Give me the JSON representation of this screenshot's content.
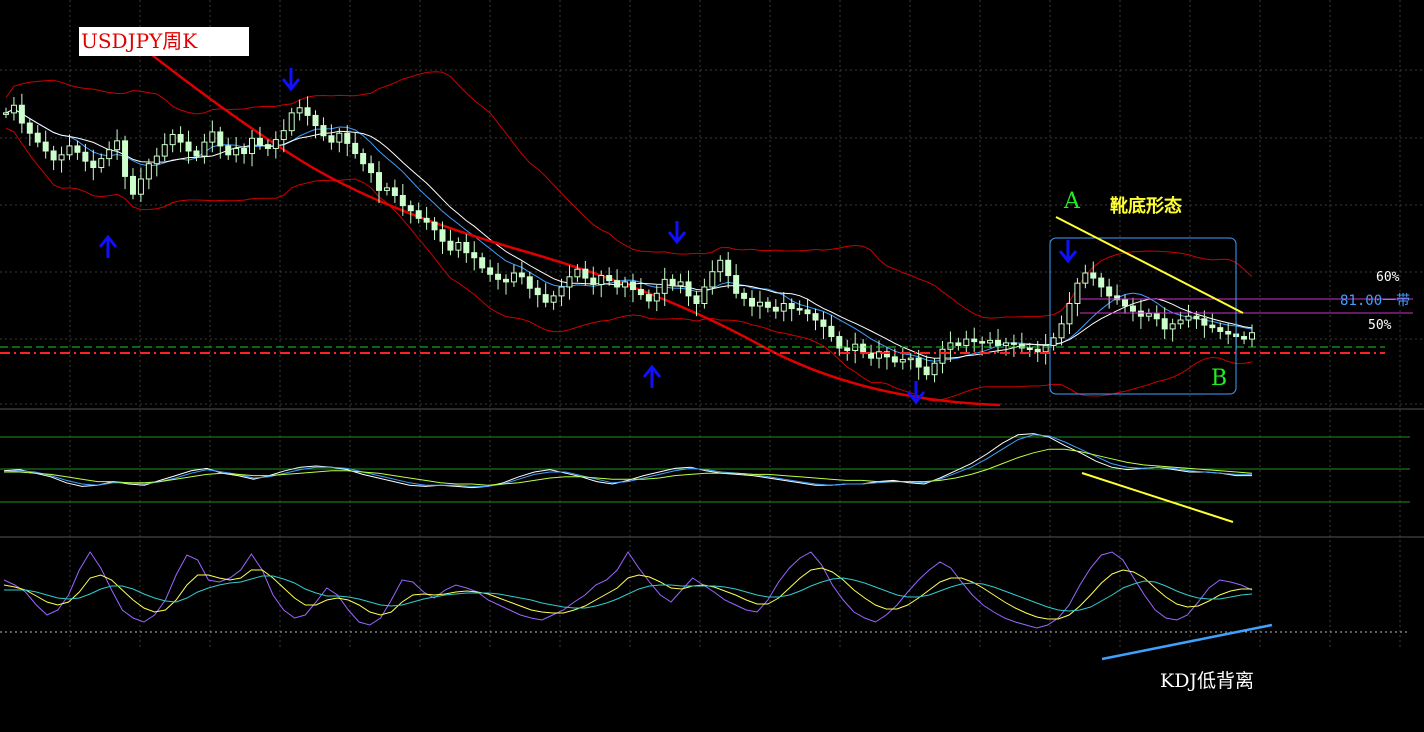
{
  "title": "USDJPY周K",
  "annotations": {
    "point_a": "A",
    "point_b": "B",
    "pattern": "靴底形态",
    "fib_60": "60%",
    "level_81": "81.00一带",
    "fib_50": "50%",
    "kdj_divergence": "KDJ低背离"
  },
  "colors": {
    "background": "#000000",
    "candle_up": "#ccffcc",
    "candle_down": "#ccffcc",
    "bollinger": "#cc0000",
    "ma_long": "#e00000",
    "ma_white": "#ffffff",
    "ma_blue": "#3f9fff",
    "arrow": "#1010ff",
    "trend_yellow": "#ffff33",
    "trend_blue": "#3fa0ff",
    "box": "#3f9fff",
    "fib_line": "#cc33cc",
    "label_green": "#22ee22"
  },
  "chart_data": [
    {
      "type": "candlestick",
      "panel": "price",
      "title": "USDJPY周K",
      "x": "weeks (index)",
      "series": [
        {
          "name": "close",
          "values": [
            101.2,
            101.8,
            100.4,
            99.6,
            98.9,
            98.2,
            97.5,
            97.9,
            98.6,
            98.1,
            97.4,
            96.9,
            97.6,
            98.3,
            99.0,
            96.2,
            94.8,
            96.0,
            97.2,
            97.8,
            98.7,
            99.5,
            98.9,
            98.2,
            97.8,
            98.9,
            99.7,
            98.6,
            97.9,
            98.4,
            98.0,
            99.2,
            98.7,
            98.4,
            99.1,
            99.8,
            101.2,
            101.6,
            101.0,
            100.2,
            99.4,
            98.9,
            99.6,
            98.8,
            98.0,
            97.2,
            96.5,
            95.1,
            95.3,
            94.7,
            93.9,
            93.5,
            92.9,
            92.6,
            92.0,
            91.1,
            90.4,
            91.0,
            90.2,
            89.8,
            89.0,
            88.5,
            88.1,
            87.9,
            88.6,
            88.3,
            87.4,
            86.9,
            86.3,
            86.8,
            87.5,
            88.3,
            88.9,
            88.2,
            87.7,
            88.4,
            88.0,
            87.5,
            87.9,
            87.3,
            86.9,
            86.4,
            87.0,
            88.1,
            87.6,
            87.9,
            86.8,
            86.2,
            87.5,
            88.7,
            89.6,
            88.4,
            87.0,
            86.6,
            86.0,
            86.3,
            85.9,
            85.6,
            86.2,
            85.8,
            85.7,
            85.4,
            84.9,
            84.4,
            83.6,
            82.7,
            82.5,
            83.0,
            82.3,
            81.9,
            82.4,
            82.0,
            81.6,
            81.8,
            81.9,
            81.2,
            80.6,
            81.5,
            82.6,
            83.1,
            82.9,
            83.4,
            83.2,
            83.1,
            83.3,
            82.9,
            83.1,
            83.0,
            82.7,
            82.6,
            82.4,
            82.9,
            83.5,
            84.6,
            86.2,
            87.8,
            88.6,
            88.2,
            87.5,
            86.8,
            86.5,
            86.0,
            85.6,
            85.2,
            85.4,
            85.0,
            84.2,
            84.6,
            84.9,
            85.2,
            85.0,
            84.5,
            84.3,
            84.0,
            83.8,
            83.6,
            83.4,
            83.9
          ]
        }
      ]
    },
    {
      "type": "line",
      "panel": "oscillator",
      "series": [
        {
          "name": "white",
          "values": [
            0.6,
            0.7,
            0.4,
            0.1,
            -0.4,
            -0.7,
            -0.6,
            -0.3,
            -0.5,
            -0.6,
            -0.2,
            0.2,
            0.6,
            0.8,
            0.4,
            0.2,
            -0.1,
            0.2,
            0.6,
            0.9,
            1.0,
            0.9,
            0.7,
            0.3,
            0.0,
            -0.3,
            -0.6,
            -0.7,
            -0.6,
            -0.7,
            -0.8,
            -0.7,
            -0.4,
            0.1,
            0.5,
            0.7,
            0.4,
            0.1,
            -0.3,
            -0.5,
            -0.2,
            0.2,
            0.5,
            0.8,
            0.9,
            0.6,
            0.4,
            0.3,
            0.2,
            0.0,
            -0.2,
            -0.4,
            -0.6,
            -0.6,
            -0.5,
            -0.5,
            -0.3,
            -0.2,
            -0.4,
            -0.5,
            0.0,
            0.6,
            1.2,
            2.0,
            2.9,
            3.6,
            3.7,
            3.4,
            2.7,
            2.1,
            1.4,
            0.9,
            0.7,
            0.8,
            0.9,
            0.7,
            0.5,
            0.5,
            0.4,
            0.2,
            0.2
          ]
        },
        {
          "name": "blue",
          "values": [
            0.5,
            0.6,
            0.5,
            0.2,
            -0.2,
            -0.5,
            -0.6,
            -0.4,
            -0.4,
            -0.5,
            -0.3,
            0.0,
            0.4,
            0.7,
            0.5,
            0.3,
            0.0,
            0.1,
            0.4,
            0.7,
            0.9,
            0.9,
            0.8,
            0.5,
            0.2,
            -0.1,
            -0.4,
            -0.6,
            -0.6,
            -0.6,
            -0.7,
            -0.7,
            -0.5,
            -0.1,
            0.3,
            0.5,
            0.5,
            0.2,
            -0.1,
            -0.4,
            -0.3,
            0.0,
            0.3,
            0.6,
            0.8,
            0.7,
            0.5,
            0.4,
            0.3,
            0.1,
            -0.1,
            -0.3,
            -0.5,
            -0.6,
            -0.5,
            -0.5,
            -0.4,
            -0.3,
            -0.3,
            -0.4,
            -0.1,
            0.4,
            0.9,
            1.6,
            2.4,
            3.2,
            3.6,
            3.5,
            3.0,
            2.4,
            1.8,
            1.2,
            0.9,
            0.8,
            0.9,
            0.8,
            0.6,
            0.5,
            0.4,
            0.3,
            0.3
          ]
        },
        {
          "name": "green",
          "values": [
            0.5,
            0.5,
            0.4,
            0.3,
            0.1,
            -0.1,
            -0.3,
            -0.3,
            -0.4,
            -0.4,
            -0.3,
            -0.1,
            0.1,
            0.3,
            0.4,
            0.3,
            0.2,
            0.2,
            0.3,
            0.4,
            0.5,
            0.6,
            0.6,
            0.5,
            0.4,
            0.2,
            0.0,
            -0.2,
            -0.4,
            -0.5,
            -0.5,
            -0.6,
            -0.5,
            -0.4,
            -0.2,
            0.0,
            0.1,
            0.1,
            0.0,
            -0.1,
            -0.1,
            -0.1,
            0.0,
            0.2,
            0.3,
            0.4,
            0.4,
            0.4,
            0.3,
            0.3,
            0.2,
            0.1,
            0.0,
            -0.1,
            -0.2,
            -0.2,
            -0.3,
            -0.3,
            -0.3,
            -0.3,
            -0.2,
            0.0,
            0.3,
            0.7,
            1.2,
            1.7,
            2.1,
            2.4,
            2.4,
            2.2,
            1.9,
            1.6,
            1.3,
            1.1,
            1.0,
            0.9,
            0.8,
            0.7,
            0.6,
            0.5,
            0.4
          ]
        }
      ]
    },
    {
      "type": "line",
      "panel": "kdj",
      "series": [
        {
          "name": "purple",
          "values": [
            60,
            55,
            48,
            35,
            25,
            30,
            45,
            70,
            88,
            72,
            50,
            30,
            22,
            18,
            25,
            40,
            65,
            85,
            80,
            60,
            58,
            62,
            70,
            86,
            70,
            45,
            30,
            22,
            25,
            38,
            52,
            45,
            30,
            18,
            15,
            22,
            40,
            60,
            58,
            48,
            42,
            50,
            55,
            52,
            48,
            40,
            35,
            30,
            25,
            22,
            20,
            25,
            30,
            38,
            45,
            55,
            60,
            70,
            88,
            72,
            58,
            45,
            38,
            50,
            62,
            55,
            48,
            40,
            35,
            30,
            28,
            40,
            58,
            72,
            82,
            88,
            75,
            55,
            40,
            28,
            22,
            18,
            25,
            35,
            48,
            60,
            70,
            78,
            72,
            58,
            45,
            35,
            28,
            22,
            18,
            15,
            12,
            15,
            22,
            35,
            55,
            72,
            85,
            88,
            80,
            62,
            45,
            30,
            22,
            20,
            25,
            38,
            52,
            60,
            58,
            55,
            50
          ]
        },
        {
          "name": "yellow",
          "values": [
            55,
            53,
            50,
            44,
            38,
            35,
            38,
            48,
            62,
            65,
            60,
            50,
            40,
            32,
            28,
            30,
            40,
            55,
            65,
            65,
            62,
            60,
            62,
            70,
            70,
            62,
            52,
            42,
            35,
            35,
            40,
            42,
            40,
            35,
            28,
            25,
            28,
            38,
            45,
            46,
            45,
            46,
            48,
            49,
            48,
            46,
            42,
            38,
            34,
            30,
            28,
            27,
            27,
            30,
            34,
            40,
            46,
            52,
            62,
            65,
            63,
            58,
            52,
            51,
            54,
            55,
            53,
            49,
            45,
            40,
            36,
            36,
            42,
            52,
            62,
            70,
            72,
            68,
            60,
            50,
            42,
            35,
            31,
            31,
            35,
            42,
            50,
            58,
            62,
            62,
            58,
            52,
            45,
            38,
            32,
            27,
            23,
            21,
            21,
            25,
            34,
            45,
            57,
            66,
            70,
            68,
            62,
            52,
            43,
            36,
            33,
            34,
            39,
            45,
            49,
            51,
            51
          ]
        },
        {
          "name": "cyan",
          "values": [
            50,
            50,
            50,
            48,
            45,
            42,
            41,
            42,
            46,
            51,
            54,
            54,
            51,
            46,
            42,
            39,
            38,
            42,
            48,
            52,
            55,
            57,
            58,
            61,
            64,
            64,
            61,
            57,
            51,
            47,
            44,
            44,
            43,
            41,
            38,
            35,
            34,
            35,
            38,
            41,
            43,
            45,
            46,
            47,
            47,
            47,
            46,
            44,
            42,
            40,
            37,
            35,
            33,
            32,
            32,
            34,
            37,
            41,
            46,
            51,
            54,
            55,
            55,
            54,
            54,
            54,
            54,
            53,
            51,
            48,
            45,
            43,
            43,
            45,
            49,
            54,
            58,
            61,
            62,
            60,
            57,
            53,
            49,
            45,
            43,
            43,
            45,
            49,
            53,
            56,
            57,
            56,
            53,
            49,
            45,
            41,
            37,
            33,
            30,
            29,
            30,
            33,
            39,
            45,
            52,
            56,
            59,
            58,
            54,
            49,
            45,
            42,
            41,
            41,
            43,
            45,
            46
          ]
        }
      ]
    }
  ]
}
